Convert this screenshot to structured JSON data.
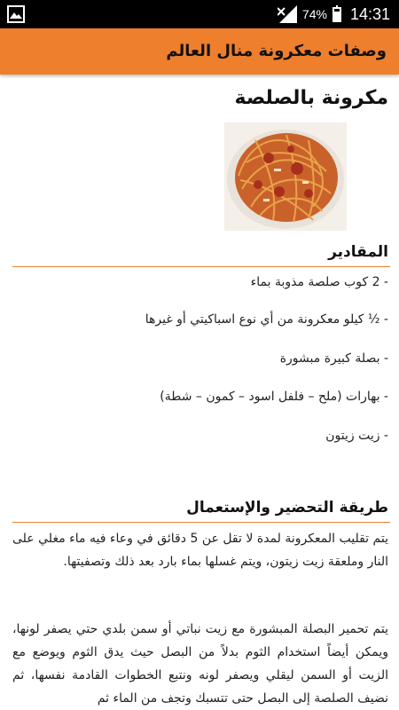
{
  "status_bar": {
    "left_icon": "image-icon",
    "signal_icon": "signal-icon",
    "battery_percent": "74%",
    "battery_level": 0.74,
    "time": "14:31"
  },
  "app_bar": {
    "title": "وصفات معكرونة منال العالم",
    "color": "#ee7f2d"
  },
  "recipe": {
    "title": "مكرونة بالصلصة",
    "ingredients_header": "المقادير",
    "ingredients": [
      "- 2 كوب صلصة مذوبة بماء",
      "- ½ كيلو معكرونة من أي نوع اسباكيتي أو غيرها",
      "- بصلة كبيرة مبشورة",
      "- بهارات (ملح – فلفل اسود – كمون – شطة)",
      "- زيت زيتون"
    ],
    "method_header": "طريقة التحضير والإستعمال",
    "steps": [
      "يتم تقليب المعكرونة لمدة لا تقل عن 5 دقائق في وعاء فيه ماء مغلي على النار وملعقة زيت زيتون، ويتم غسلها بماء بارد بعد ذلك وتصفيتها.",
      "يتم تحمير البصلة المبشورة مع زيت نباتي أو سمن بلدي حتي يصفر لونها، ويمكن أيضاً استخدام الثوم بدلاً من البصل حيث يدق الثوم ويوضع مع الزيت أو السمن ليقلي ويصفر لونه ونتبع الخطوات القادمة نفسها، ثم نضيف الصلصة إلى البصل حتى تتسبك وتجف من الماء ثم"
    ]
  }
}
